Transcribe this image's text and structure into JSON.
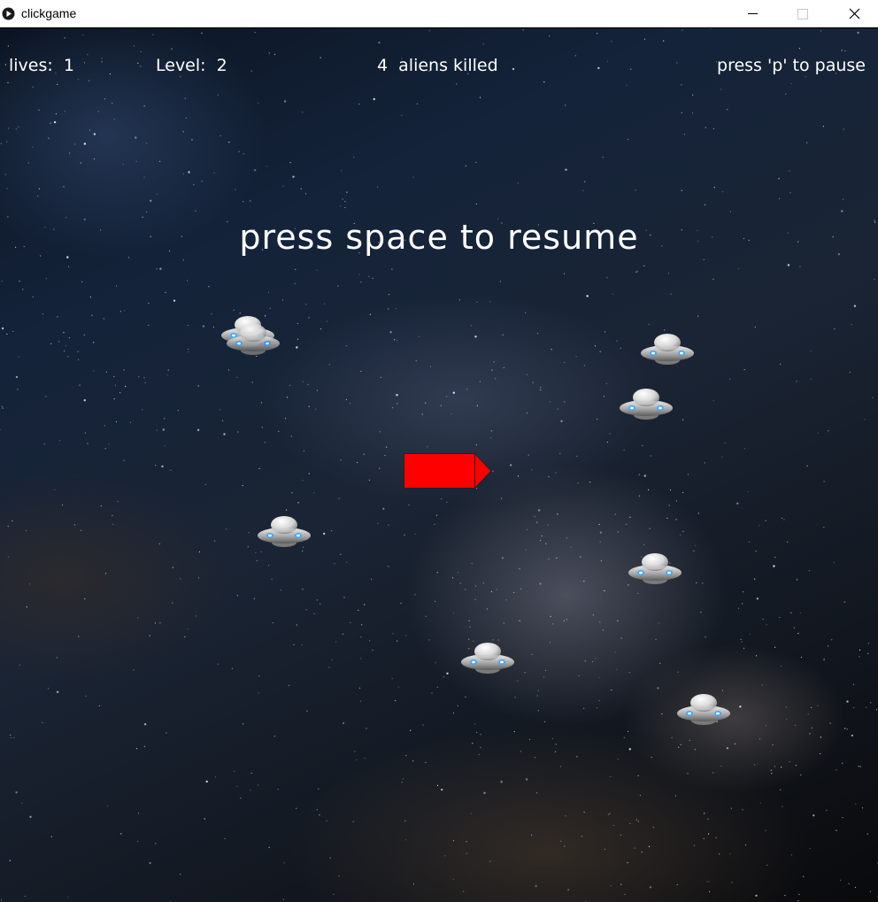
{
  "window": {
    "title": "clickgame",
    "icons": [
      "app-play-icon",
      "minimize-icon",
      "maximize-icon",
      "close-icon"
    ]
  },
  "hud": {
    "lives": "lives:  1",
    "level": "Level:  2",
    "kills": "4  aliens killed",
    "pause_hint": "press 'p' to pause"
  },
  "overlay": {
    "message": "press space to resume"
  },
  "entities": {
    "aliens": 8,
    "alien_icon": "ufo-icon",
    "player_icon": "ship-icon",
    "player_color": "#ff0000"
  }
}
